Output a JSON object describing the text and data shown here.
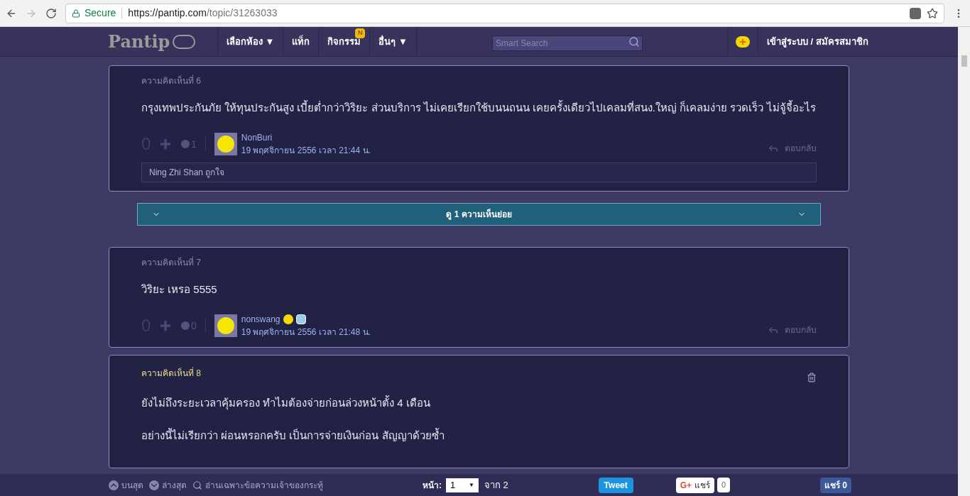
{
  "browser": {
    "secure_label": "Secure",
    "url_host": "https://pantip.com",
    "url_path": "/topic/31263033"
  },
  "nav": {
    "logo": "Pantip",
    "menu": [
      {
        "label": "เลือกห้อง ▼"
      },
      {
        "label": "แท็ก"
      },
      {
        "label": "กิจกรรม",
        "badge": "N"
      },
      {
        "label": "อื่นๆ ▼"
      }
    ],
    "search": {
      "placeholder": "Smart Search"
    },
    "login": "เข้าสู่ระบบ / สมัครสมาชิก"
  },
  "comments": [
    {
      "number": "ความคิดเห็นที่ 6",
      "highlighted": false,
      "deletable": false,
      "paragraphs": [
        "กรุงเทพประกันภัย ให้ทุนประกันสูง เบี้ยต่ำกว่าวิริยะ ส่วนบริการ ไม่เคยเรียกใช้บนนถนน เคยครั้งเดียวไปเคลมที่สนง.ใหญ่ ก็เคลมง่าย รวดเร็ว ไม่จู้จี้อะไร"
      ],
      "score": "0",
      "emotions": "1",
      "author": "NonBuri",
      "author_badges": false,
      "time": "19 พฤศจิกายน 2556 เวลา 21:44 น.",
      "reply": "ตอบกลับ",
      "likes": "Ning Zhi Shan ถูกใจ",
      "subcomments": "ดู 1 ความเห็นย่อย"
    },
    {
      "number": "ความคิดเห็นที่ 7",
      "highlighted": false,
      "deletable": false,
      "paragraphs": [
        "วิริยะ เหรอ 5555"
      ],
      "score": "0",
      "emotions": "0",
      "author": "nonswang",
      "author_badges": true,
      "time": "19 พฤศจิกายน 2556 เวลา 21:48 น.",
      "reply": "ตอบกลับ"
    },
    {
      "number": "ความคิดเห็นที่ 8",
      "highlighted": true,
      "deletable": true,
      "paragraphs": [
        "ยังไม่ถึงระยะเวลาคุ้มครอง  ทำไมต้องจ่ายก่อนล่วงหน้าตั้ง 4 เดือน",
        "อย่างนี้ไม่เรียกว่า ผ่อนหรอกครับ  เป็นการจ่ายเงินก่อน สัญญาด้วยซ้ำ"
      ]
    }
  ],
  "footer": {
    "top": "บนสุด",
    "bottom": "ล่างสุด",
    "owner_only": "อ่านเฉพาะข้อความเจ้าของกระทู้",
    "page_label": "หน้า:",
    "page_value": "1",
    "page_arrow": "▼",
    "page_total": "จาก 2",
    "tweet": "Tweet",
    "gplus_mark": "G+",
    "gplus": "แชร์",
    "gplus_count": "0",
    "fb": "แชร์ 0"
  }
}
